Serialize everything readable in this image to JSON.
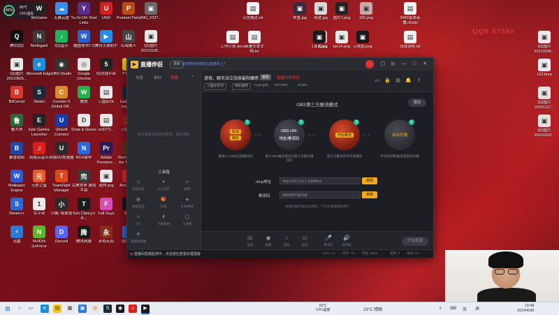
{
  "colors": {
    "accent": "#f4a91b",
    "teal": "#1bbf9a",
    "danger": "#e03a3a",
    "link": "#6b8cff"
  },
  "widget": {
    "percent": "45%",
    "line1": "60℃",
    "line2": "CPU温度"
  },
  "watermark": "QQ8 0758n",
  "desktop_icons": [
    {
      "label": "360压缩",
      "color": "#2d9cff",
      "glyph": "3"
    },
    {
      "label": "WeGame",
      "color": "#222",
      "glyph": "W"
    },
    {
      "label": "天翼云盘",
      "color": "#3a8ee6",
      "glyph": "☁"
    },
    {
      "label": "Yu-Gi-Oh! Duel Links",
      "color": "#5a2e8a",
      "glyph": "Y"
    },
    {
      "label": "UNO",
      "color": "#d32020",
      "glyph": "U"
    },
    {
      "label": "Pummel Party",
      "color": "#b84a1a",
      "glyph": "P"
    },
    {
      "label": "IMG_0227...",
      "color": "#6a6a6a",
      "glyph": "▣"
    },
    {
      "label": "腾讯QQ",
      "color": "#111",
      "glyph": "Q"
    },
    {
      "label": "Northgard",
      "color": "#3a3a3a",
      "glyph": "N"
    },
    {
      "label": "QQ音乐",
      "color": "#1fb35b",
      "glyph": "♪"
    },
    {
      "label": "酷图老师7.0",
      "color": "#2a62c9",
      "glyph": "W"
    },
    {
      "label": "腾讯手游助手",
      "color": "#1f8fe8",
      "glyph": "▶"
    },
    {
      "label": "山海旅人",
      "color": "#444",
      "glyph": "山"
    },
    {
      "label": "QQ图片 20210105...",
      "color": "#e8e8e8",
      "glyph": "▣"
    },
    {
      "label": "QQ图片 20210825...",
      "color": "#e8e8e8",
      "glyph": "▣"
    },
    {
      "label": "Microsoft Edge",
      "color": "#1a8fd8",
      "glyph": "e"
    },
    {
      "label": "OBS Studio",
      "color": "#333",
      "glyph": "◉"
    },
    {
      "label": "Google Chrome",
      "color": "#e8e8e8",
      "glyph": "◎"
    },
    {
      "label": "53对战平台",
      "color": "#222",
      "glyph": "5"
    },
    {
      "label": "YY语音",
      "color": "#f3c41a",
      "glyph": "Y"
    },
    {
      "label": "Plague Inc: Evolved",
      "color": "#8a1a1a",
      "glyph": "☣"
    },
    {
      "label": "BitComet",
      "color": "#d8372a",
      "glyph": "B"
    },
    {
      "label": "Steam",
      "color": "#1b2838",
      "glyph": "S"
    },
    {
      "label": "Counter-S Global Off...",
      "color": "#d98a2a",
      "glyph": "C"
    },
    {
      "label": "微信",
      "color": "#21b04b",
      "glyph": "W"
    },
    {
      "label": "三国杀OL",
      "color": "#e8e8e8",
      "glyph": "▤"
    },
    {
      "label": "League of Legends",
      "color": "#1a2a3a",
      "glyph": "L"
    },
    {
      "label": "回收站",
      "color": "#c8c8c8",
      "glyph": "♻"
    },
    {
      "label": "鲁大师",
      "color": "#2a6a3a",
      "glyph": "鲁"
    },
    {
      "label": "Epic Games Launcher",
      "color": "#222",
      "glyph": "E"
    },
    {
      "label": "Ubisoft Connect",
      "color": "#1a3aa8",
      "glyph": "U"
    },
    {
      "label": "Draw & Guess",
      "color": "#e8e8e8",
      "glyph": "D"
    },
    {
      "label": "un3771...",
      "color": "#e8e8e8",
      "glyph": "▤"
    },
    {
      "label": "三国杀14",
      "color": "#a01a1a",
      "glyph": "三"
    },
    {
      "label": "百度网盘",
      "color": "#2a7ae8",
      "glyph": "◆"
    },
    {
      "label": "暴雪战网",
      "color": "#1a4aa8",
      "glyph": "B"
    },
    {
      "label": "网易云音乐",
      "color": "#d8201a",
      "glyph": "♫"
    },
    {
      "label": "网易UU加速器",
      "color": "#2a2a2a",
      "glyph": "U"
    },
    {
      "label": "NCH套件",
      "color": "#2a6ad8",
      "glyph": "N"
    },
    {
      "label": "Adobe Premiere...",
      "color": "#2a1a5a",
      "glyph": "Pr"
    },
    {
      "label": "Romance of the Three...",
      "color": "#5a3a1a",
      "glyph": "R"
    },
    {
      "label": "三国杀十周年",
      "color": "#d8a82a",
      "glyph": "三"
    },
    {
      "label": "Wallpaper Engine",
      "color": "#2a5ad8",
      "glyph": "W"
    },
    {
      "label": "元梦之星",
      "color": "#e85a2a",
      "glyph": "元"
    },
    {
      "label": "TeamFight Manager",
      "color": "#d84a1a",
      "glyph": "T"
    },
    {
      "label": "完美世界 游戏平台",
      "color": "#3a3a3a",
      "glyph": "完"
    },
    {
      "label": "双押.png",
      "color": "#e8e8e8",
      "glyph": "▣"
    },
    {
      "label": "Among Us",
      "color": "#d82a2a",
      "glyph": "A"
    },
    {
      "label": "Cheat Engine",
      "color": "#e8e8e8",
      "glyph": "C"
    },
    {
      "label": "Steam++",
      "color": "#2a6ad8",
      "glyph": "S"
    },
    {
      "label": "11平台",
      "color": "#e8e8e8",
      "glyph": "1"
    },
    {
      "label": "小鹅- 吸血鬼",
      "color": "#2a2a2a",
      "glyph": "小"
    },
    {
      "label": "Tom Clancy's R...",
      "color": "#1a1a1a",
      "glyph": "T"
    },
    {
      "label": "Fall Guys",
      "color": "#d84ab8",
      "glyph": "F"
    },
    {
      "label": "BOX",
      "color": "#1a1a1a",
      "glyph": "X"
    },
    {
      "label": "生化危机",
      "color": "#5a1a1a",
      "glyph": "生"
    },
    {
      "label": "迅雷",
      "color": "#2a7ad8",
      "glyph": "⚡"
    },
    {
      "label": "NVIDIA GeForce",
      "color": "#5ab82a",
      "glyph": "N"
    },
    {
      "label": "Discord",
      "color": "#5865f2",
      "glyph": "D"
    },
    {
      "label": "腾讯网游",
      "color": "#1a1a1a",
      "glyph": "腾"
    },
    {
      "label": "永劫无间",
      "color": "#8a2a1a",
      "glyph": "永"
    },
    {
      "label": "QQ飞车",
      "color": "#2a6ad8",
      "glyph": "Q"
    },
    {
      "label": "公告格式.txt",
      "color": "#f0f0f0",
      "glyph": "▤"
    },
    {
      "label": "布置.jpg",
      "color": "#3a2a3a",
      "glyph": "▣"
    },
    {
      "label": "奇迹.jpg",
      "color": "#d8d8d8",
      "glyph": "▣"
    },
    {
      "label": "图片1.png",
      "color": "#222",
      "glyph": "▣"
    },
    {
      "label": "325.png",
      "color": "#c8a8a8",
      "glyph": "▣"
    },
    {
      "label": "SWF版本英播.cfmdx",
      "color": "#f0f0f0",
      "glyph": "▤"
    },
    {
      "label": "斗图.jpg",
      "color": "#d8c8c8",
      "glyph": "▣"
    },
    {
      "label": "工作计划.docx",
      "color": "#f0f0f0",
      "glyph": "▤"
    },
    {
      "label": "新建文本文档.txt",
      "color": "#f0f0f0",
      "glyph": "▤"
    },
    {
      "label": "1.3.4.png",
      "color": "#1a1a1a",
      "glyph": "▣"
    },
    {
      "label": "lan14.png",
      "color": "#e8e8e8",
      "glyph": "▣"
    },
    {
      "label": "示意图.png",
      "color": "#1a1a1a",
      "glyph": "▣"
    },
    {
      "label": "出现说明.txt",
      "color": "#f0f0f0",
      "glyph": "▤"
    },
    {
      "label": "QQ图片 20210205...",
      "color": "#f0e8e8",
      "glyph": "▣"
    },
    {
      "label": "123.bmp",
      "color": "#e8e8f0",
      "glyph": "▣"
    },
    {
      "label": "QQ图片 20201117...",
      "color": "#e8e0e0",
      "glyph": "▣"
    },
    {
      "label": "QQ图片 20201023...",
      "color": "#e0e0e0",
      "glyph": "▣"
    }
  ],
  "app": {
    "logo": "直播伴侣",
    "version": "更新",
    "notice": "如何把时长绑定在直播本上？",
    "window_buttons": [
      "▢",
      "◎",
      "—",
      "□",
      "✕"
    ],
    "left_tabs": [
      "场景",
      "素材",
      "观看"
    ],
    "left_hint": "您还没有添加任何素材，请先添加",
    "tools_title": "工具箱",
    "tools": [
      {
        "label": "互动玩法",
        "glyph": "◇"
      },
      {
        "label": "火力全开",
        "glyph": "✦"
      },
      {
        "label": "表情",
        "glyph": "☺"
      },
      {
        "label": "高级玩法",
        "glyph": "▤"
      },
      {
        "label": "礼物",
        "glyph": "🎁"
      },
      {
        "label": "礼物特效",
        "glyph": "◈"
      },
      {
        "label": "PK",
        "glyph": "⚔"
      },
      {
        "label": "下载素材",
        "glyph": "⬇"
      },
      {
        "label": "小游戏",
        "glyph": "◯"
      },
      {
        "label": "直播间管理",
        "glyph": "⚙"
      }
    ],
    "room_title": "游戏，聊天治立张原最阳康感",
    "edit": "修改",
    "live_title": "直播内容待定",
    "chips": [
      "三国杀系列",
      "精彩推荐"
    ],
    "meta": [
      "Fuying56",
      "6873467",
      "44453"
    ],
    "mode_title": "OBS第三方推流模式",
    "exit": "退出",
    "steps": [
      {
        "num": "1",
        "tag1": "取消",
        "tag2": "确定",
        "desc": "重新In any段位直播间间"
      },
      {
        "num": "2",
        "line1": "OBS URL",
        "line2": "地址/推流码",
        "desc": "填入OBS推流地址与第三方推流推流码"
      },
      {
        "num": "3",
        "tag1": "开始推流",
        "desc": "第三方推流软件开启推流"
      },
      {
        "num": "4",
        "line1": "自动开播",
        "desc": "平台检测到推流后自动开播"
      }
    ],
    "rtmp_label": "rtmp地址",
    "rtmp_value": "rtmp://127.0.0.1:1935/live",
    "key_label": "推流码",
    "key_value": "90FA5B7AE338",
    "copy": "复制",
    "hint": "关播后推流地址会更新，下次开播请重新填写",
    "bottom_tools": [
      {
        "label": "连线",
        "glyph": "☏"
      },
      {
        "label": "观看",
        "glyph": "◉"
      },
      {
        "label": "音效",
        "glyph": "♪"
      },
      {
        "label": "投屏",
        "glyph": "▭"
      },
      {
        "label": "麦克风",
        "glyph": "🎤"
      },
      {
        "label": "扬声器",
        "glyph": "🔊"
      }
    ],
    "start": "开始直播",
    "status_msg": "直播间直播监测中，点击前往查看处理措施",
    "status_items": [
      "CPU: 1%",
      "内存: 7%",
      "带宽: 0kb/s",
      "帧率: 0",
      "丢帧: 0%"
    ]
  },
  "taskbar": {
    "cpu_temp": "60℃",
    "cpu_label": "CPU温度",
    "weather": "23°C 晴朗",
    "time": "19:49",
    "date": "2024/4/30",
    "tray": [
      "∧",
      "⌨",
      "英",
      "🔊"
    ]
  }
}
